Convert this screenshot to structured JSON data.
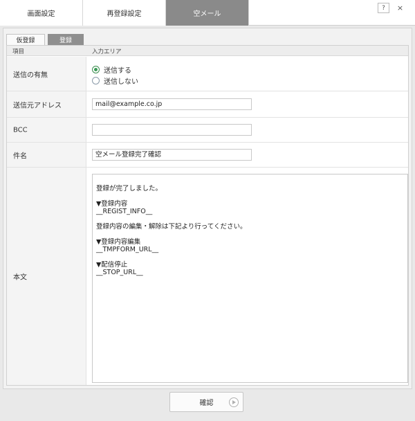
{
  "top_tabs": [
    {
      "label": "画面設定"
    },
    {
      "label": "再登録設定"
    },
    {
      "label": "空メール"
    }
  ],
  "window_buttons": {
    "help": "?",
    "close": "×"
  },
  "sub_tabs": [
    {
      "label": "仮登録"
    },
    {
      "label": "登録"
    }
  ],
  "table_header": {
    "item": "項目",
    "input_area": "入力エリア"
  },
  "fields": {
    "send": {
      "label": "送信の有無",
      "options": [
        "送信する",
        "送信しない"
      ],
      "selected": "送信する"
    },
    "from": {
      "label": "送信元アドレス",
      "value": "mail@example.co.jp"
    },
    "bcc": {
      "label": "BCC",
      "value": ""
    },
    "subject": {
      "label": "件名",
      "value": "空メール登録完了確認"
    },
    "body": {
      "label": "本文",
      "value": "登録が完了しました。\n\n▼登録内容\n__REGIST_INFO__\n\n登録内容の編集・解除は下記より行ってください。\n\n▼登録内容編集\n__TMPFORM_URL__\n\n▼配信停止\n__STOP_URL__"
    }
  },
  "confirm_button": {
    "label": "確認"
  }
}
